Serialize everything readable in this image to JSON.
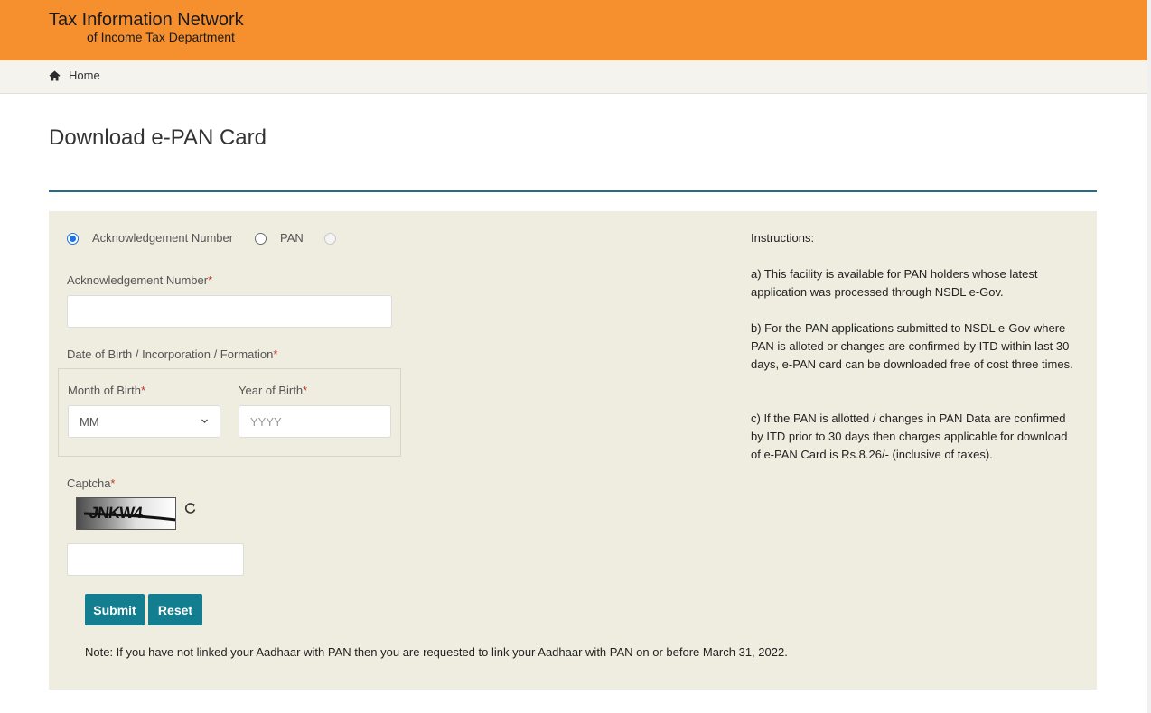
{
  "header": {
    "brand_line1": "Tax Information Network",
    "brand_line2": "of Income Tax Department",
    "background_color": "#f68f2e"
  },
  "breadcrumb": {
    "icon": "home-icon",
    "label": "Home"
  },
  "page": {
    "title": "Download e-PAN Card",
    "rule_color": "#1f6f8b",
    "panel_color": "#efede0"
  },
  "form": {
    "radio_options": [
      {
        "label": "Acknowledgement Number",
        "selected": true
      },
      {
        "label": "PAN",
        "selected": false
      },
      {
        "label": "",
        "selected": false,
        "disabled": true
      }
    ],
    "ack_number_label": "Acknowledgement Number",
    "ack_number_value": "",
    "dob_label": "Date of Birth / Incorporation / Formation",
    "month_label": "Month of Birth",
    "month_selected": "MM",
    "year_label": "Year of Birth",
    "year_placeholder": "YYYY",
    "year_value": "",
    "required_marker": "*",
    "captcha_label": "Captcha",
    "captcha_text": "JNKW4",
    "captcha_value": "",
    "submit_label": "Submit",
    "reset_label": "Reset",
    "button_color": "#137e8f",
    "note": "Note: If you have not linked your Aadhaar with PAN then you are requested to link your Aadhaar with PAN on or before March 31, 2022."
  },
  "instructions": {
    "heading": "Instructions:",
    "items": [
      "a) This facility is available for PAN holders whose latest application was processed through NSDL e-Gov.",
      "b) For the PAN applications submitted to NSDL e-Gov where PAN is alloted or changes are confirmed by ITD within last 30 days, e-PAN card can be downloaded free of cost three times.",
      "c) If the PAN is allotted / changes in PAN Data are confirmed by ITD prior to 30 days then charges applicable for download of e-PAN Card is Rs.8.26/- (inclusive of taxes)."
    ]
  }
}
